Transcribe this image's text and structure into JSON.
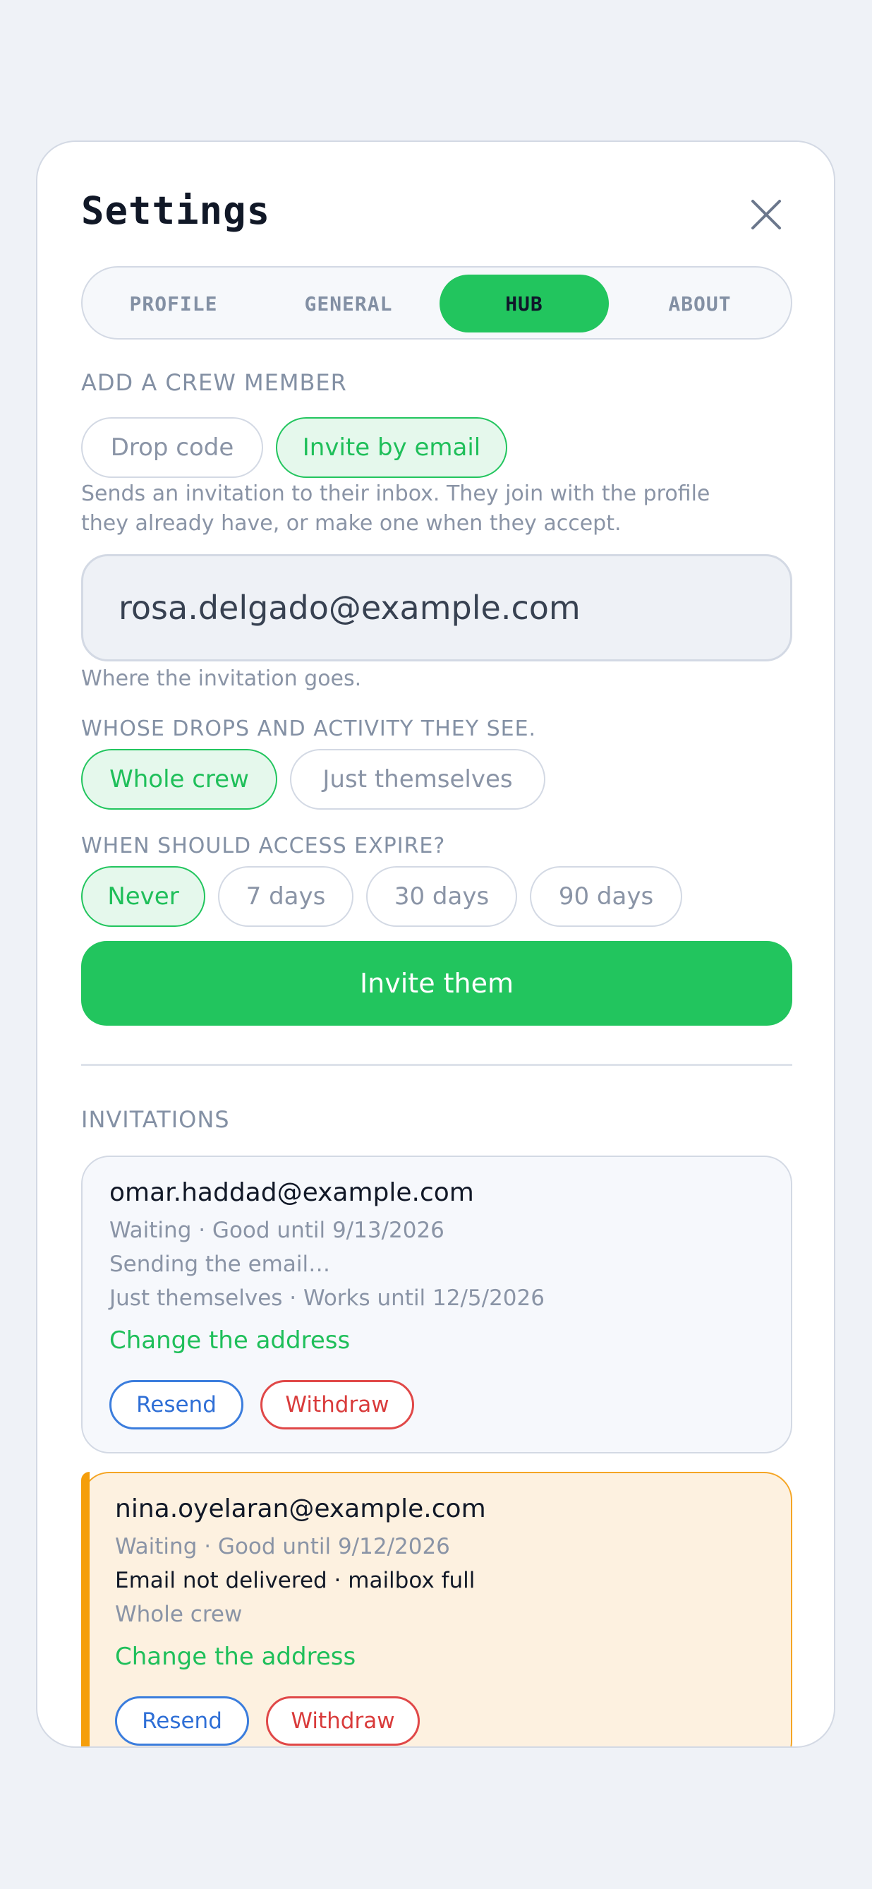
{
  "header": {
    "title": "Settings",
    "close_icon": "close-icon"
  },
  "tabs": [
    {
      "label": "PROFILE",
      "active": false
    },
    {
      "label": "GENERAL",
      "active": false
    },
    {
      "label": "HUB",
      "active": true
    },
    {
      "label": "ABOUT",
      "active": false
    }
  ],
  "add_member": {
    "heading": "ADD A CREW MEMBER",
    "methods": [
      {
        "label": "Drop code",
        "selected": false
      },
      {
        "label": "Invite by email",
        "selected": true
      }
    ],
    "description_line1": "Sends an invitation to their inbox. They join with the profile",
    "description_line2": "they already have, or make one when they accept.",
    "email_value": "rosa.delgado@example.com",
    "email_hint": "Where the invitation goes.",
    "scope_heading": "WHOSE DROPS AND ACTIVITY THEY SEE.",
    "scope_options": [
      {
        "label": "Whole crew",
        "selected": true
      },
      {
        "label": "Just themselves",
        "selected": false
      }
    ],
    "expire_heading": "WHEN SHOULD ACCESS EXPIRE?",
    "expire_options": [
      {
        "label": "Never",
        "selected": true
      },
      {
        "label": "7 days",
        "selected": false
      },
      {
        "label": "30 days",
        "selected": false
      },
      {
        "label": "90 days",
        "selected": false
      }
    ],
    "submit_label": "Invite them"
  },
  "invitations": {
    "heading": "INVITATIONS",
    "items": [
      {
        "email": "omar.haddad@example.com",
        "status": "Waiting · Good until 9/13/2026",
        "delivery": "Sending the email…",
        "scope": "Just themselves · Works until 12/5/2026",
        "change_label": "Change the address",
        "resend_label": "Resend",
        "withdraw_label": "Withdraw"
      },
      {
        "email": "nina.oyelaran@example.com",
        "status": "Waiting · Good until 9/12/2026",
        "delivery": "Email not delivered · mailbox full",
        "scope": "Whole crew",
        "change_label": "Change the address",
        "resend_label": "Resend",
        "withdraw_label": "Withdraw"
      }
    ]
  },
  "colors": {
    "accent": "#22c55e",
    "warning": "#f59e0b",
    "danger": "#e04848",
    "link_blue": "#3b7ddd"
  }
}
